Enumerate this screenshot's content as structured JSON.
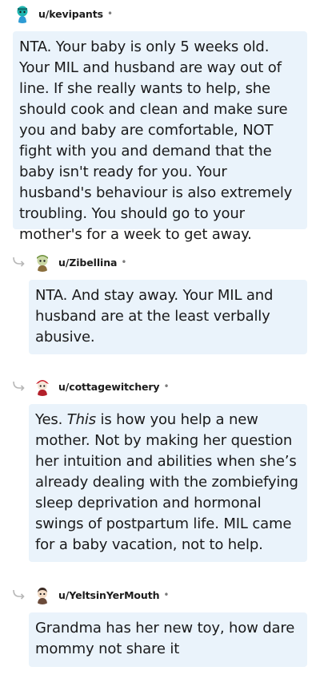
{
  "comments": [
    {
      "username": "u/kevipants",
      "separator": "•",
      "avatar_icon": "teal-snoo-avatar-icon",
      "body": "NTA. Your baby is only 5 weeks old. Your MIL and husband are way out of line. If she really wants to help, she should cook and clean and make sure you and baby are comfortable, NOT fight with you and demand that the baby isn't ready for you. Your husband's behaviour is also extremely troubling. You should go to your mother's for a week to get away."
    },
    {
      "username": "u/Zibellina",
      "separator": "•",
      "avatar_icon": "green-snoo-avatar-icon",
      "body": "NTA. And stay away. Your MIL and husband are at the least verbally abusive."
    },
    {
      "username": "u/cottagewitchery",
      "separator": "•",
      "avatar_icon": "red-hat-snoo-avatar-icon",
      "body_parts": {
        "pre": "Yes. ",
        "emph": "This",
        "post": " is how you help a new mother. Not by making her question her intuition and abilities when she’s already dealing with the zombiefying sleep deprivation and hormonal swings of postpartum life. MIL came for a baby vacation, not to help."
      }
    },
    {
      "username": "u/YeltsinYerMouth",
      "separator": "•",
      "avatar_icon": "dark-hair-snoo-avatar-icon",
      "body": "Grandma has her new toy, how dare mommy not share it"
    }
  ],
  "colors": {
    "bubble_bg": "#eaf3fb",
    "text": "#1a1a1b",
    "username": "#1c1c1c",
    "reply_arrow": "#b7b7b7"
  }
}
